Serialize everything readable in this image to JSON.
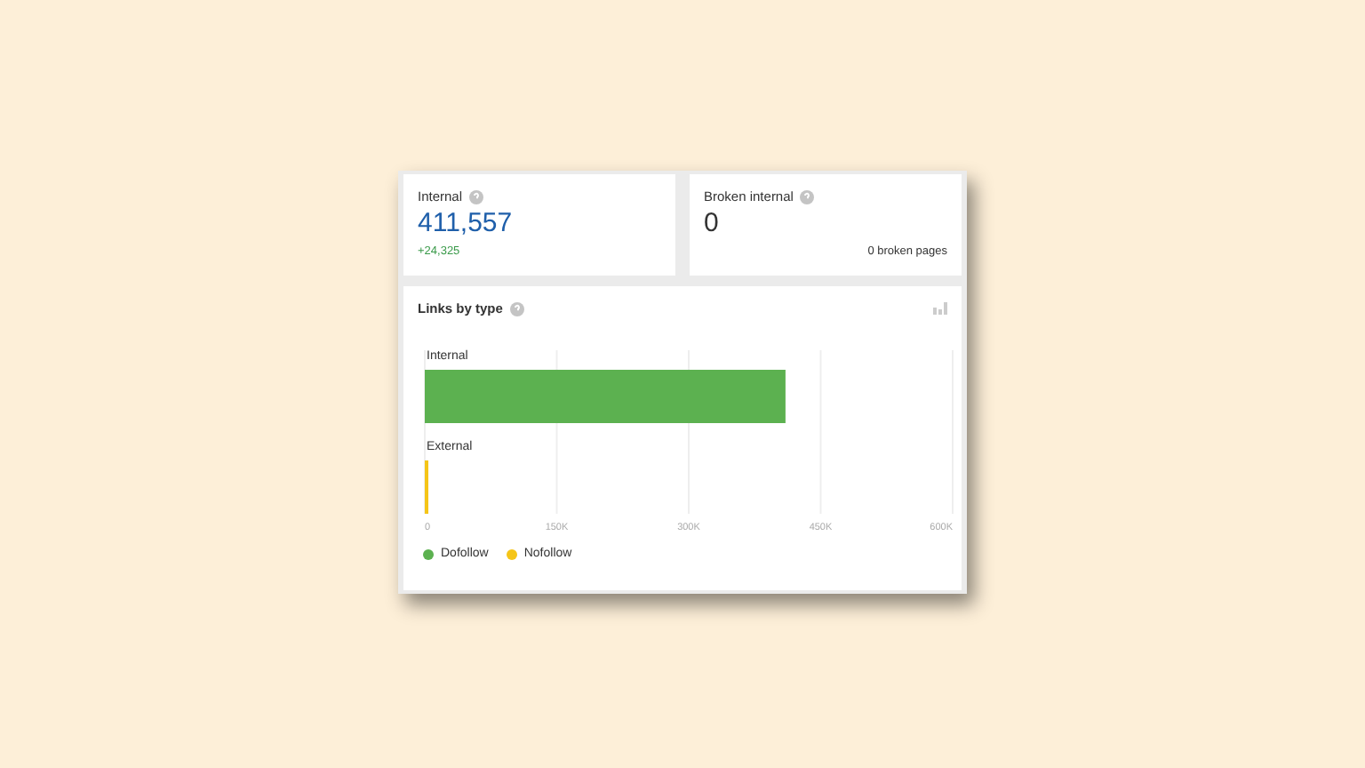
{
  "cards": [
    {
      "title": "Internal",
      "value": "411,557",
      "link": true,
      "delta": "+24,325"
    },
    {
      "title": "Broken internal",
      "value": "0",
      "link": false,
      "note": "0 broken pages"
    }
  ],
  "links_by_type": {
    "title": "Links by type",
    "chart_data": {
      "type": "bar",
      "orientation": "horizontal",
      "stacked": true,
      "grid": true,
      "categories": [
        "Internal",
        "External"
      ],
      "xlim": [
        0,
        600000
      ],
      "xticks": [
        {
          "value": 0,
          "label": "0"
        },
        {
          "value": 150000,
          "label": "150K"
        },
        {
          "value": 300000,
          "label": "300K"
        },
        {
          "value": 450000,
          "label": "450K"
        },
        {
          "value": 600000,
          "label": "600K"
        }
      ],
      "series": [
        {
          "name": "Dofollow",
          "color": "#5cb150",
          "values": [
            410000,
            0
          ]
        },
        {
          "name": "Nofollow",
          "color": "#f5c518",
          "values": [
            0,
            3000
          ]
        }
      ]
    }
  }
}
